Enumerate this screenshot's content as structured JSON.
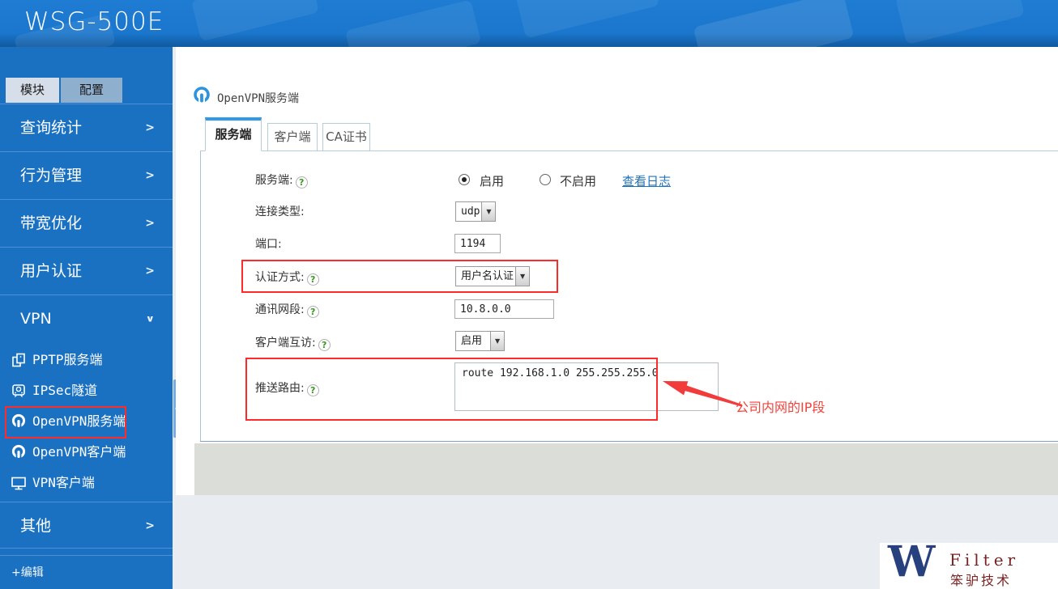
{
  "header": {
    "brand": "WSG-500E"
  },
  "sidebar": {
    "tabs": [
      {
        "label": "模块"
      },
      {
        "label": "配置"
      }
    ],
    "menu": [
      {
        "label": "查询统计",
        "chevron": ">"
      },
      {
        "label": "行为管理",
        "chevron": ">"
      },
      {
        "label": "带宽优化",
        "chevron": ">"
      },
      {
        "label": "用户认证",
        "chevron": ">"
      },
      {
        "label": "VPN",
        "chevron": "∨"
      }
    ],
    "submenu": [
      {
        "label": "PPTP服务端",
        "icon": "copy-icon"
      },
      {
        "label": "IPSec隧道",
        "icon": "tunnel-icon"
      },
      {
        "label": "OpenVPN服务端",
        "icon": "openvpn-icon",
        "highlighted": true
      },
      {
        "label": "OpenVPN客户端",
        "icon": "openvpn-icon"
      },
      {
        "label": "VPN客户端",
        "icon": "monitor-icon"
      }
    ],
    "other_item": {
      "label": "其他",
      "chevron": ">"
    },
    "edit_label": "+编辑"
  },
  "main": {
    "page_title": "OpenVPN服务端",
    "tabs": [
      {
        "label": "服务端",
        "active": true
      },
      {
        "label": "客户端",
        "active": false
      },
      {
        "label": "CA证书",
        "active": false
      }
    ],
    "form": {
      "help_icon": "?",
      "server_label": "服务端:",
      "server_enable": "启用",
      "server_disable": "不启用",
      "server_selected": "启用",
      "view_log_link": "查看日志",
      "conn_type_label": "连接类型:",
      "conn_type_value": "udp",
      "port_label": "端口:",
      "port_value": "1194",
      "auth_label": "认证方式:",
      "auth_value": "用户名认证",
      "subnet_label": "通讯网段:",
      "subnet_value": "10.8.0.0",
      "c2c_label": "客户端互访:",
      "c2c_value": "启用",
      "push_route_label": "推送路由:",
      "push_route_value": "route 192.168.1.0 255.255.255.0",
      "select_arrow": "▼"
    },
    "annotation": {
      "text": "公司内网的IP段"
    }
  },
  "watermark": {
    "w": "W",
    "name": "Filter",
    "cn": "笨驴技术"
  },
  "colors": {
    "header_blue": "#1b77cd",
    "sidebar_blue": "#1a71c2",
    "tab_accent": "#2e9ae8",
    "link_blue": "#2173bb",
    "highlight_red": "#ff2b2b",
    "annotation_red": "#f2433d"
  }
}
